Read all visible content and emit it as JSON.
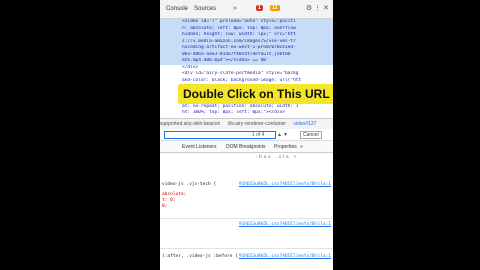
{
  "devtools": {
    "tabs": [
      "Console",
      "Sources"
    ],
    "more_tabs": "»",
    "badges": {
      "errors": "1",
      "warnings": "12"
    },
    "icons": [
      "gear-icon",
      "more-icon",
      "close-icon"
    ]
  },
  "elements": {
    "lines": [
      {
        "text": "<video id=\"7\" preload=\"auto\" style=\"positi",
        "selected": true
      },
      {
        "text": "n: absolute; left: 0px; top: 0px; overflow",
        "selected": true
      },
      {
        "text": "hidden; height: low; width: lpx;\" src=\"htt",
        "selected": true
      },
      {
        "text": "s://v.media-amazon.com/images/S/vse-vms-tr",
        "selected": true
      },
      {
        "text": "nscoding-artifact-eu-west-1-prod/070ce1ed-",
        "selected": true
      },
      {
        "text": "0b3-4065-a4e3-81da7f40cdf/default.jobtem",
        "selected": true
      },
      {
        "text": "ate.mp4.480.mp4\"></video> == $0",
        "selected": true
      },
      {
        "text": "</div>",
        "selected": false
      },
      {
        "text": "<div id=\"airy-slate-portmedia\" style=\"backg",
        "selected": false
      },
      {
        "text": "and-color: black; background-image: url(\"htt",
        "selected": false
      },
      {
        "text": "",
        "selected": false
      },
      {
        "text": "",
        "selected": false
      },
      {
        "text": "",
        "selected": false
      },
      {
        "text": "at: no-repeat; position: absolute; width: 1",
        "selected": false
      },
      {
        "text": "ht: 100%; top: 0px; left: 0px;\"></div>",
        "selected": false
      }
    ],
    "caption": "Double Click on This URL"
  },
  "breadcrumbs": [
    "supported.airy-skin-beacon",
    "div.airy-renderer-container",
    "video#137"
  ],
  "search": {
    "count": "1 of 4",
    "cancel_label": "Cancel"
  },
  "styles_tabs": [
    "Event Listeners",
    "DOM Breakpoints",
    "Properties",
    "»"
  ],
  "filter": {
    "hov": ":hov .cls +"
  },
  "rules": [
    {
      "selector": "video-js .vjs-tech {",
      "source": "91hD23u8k5L.css?AUIClients/Brila:1"
    },
    {
      "selector": "",
      "source": "91hD23u8k5L.css?AUIClients/Brila:1"
    },
    {
      "selector": "(:after, .video-js :before {",
      "source": "91hD23u8k5L.css?AUIClients/Brila:1"
    }
  ],
  "properties": [
    "absolute;",
    "t: 0;",
    "0;"
  ]
}
